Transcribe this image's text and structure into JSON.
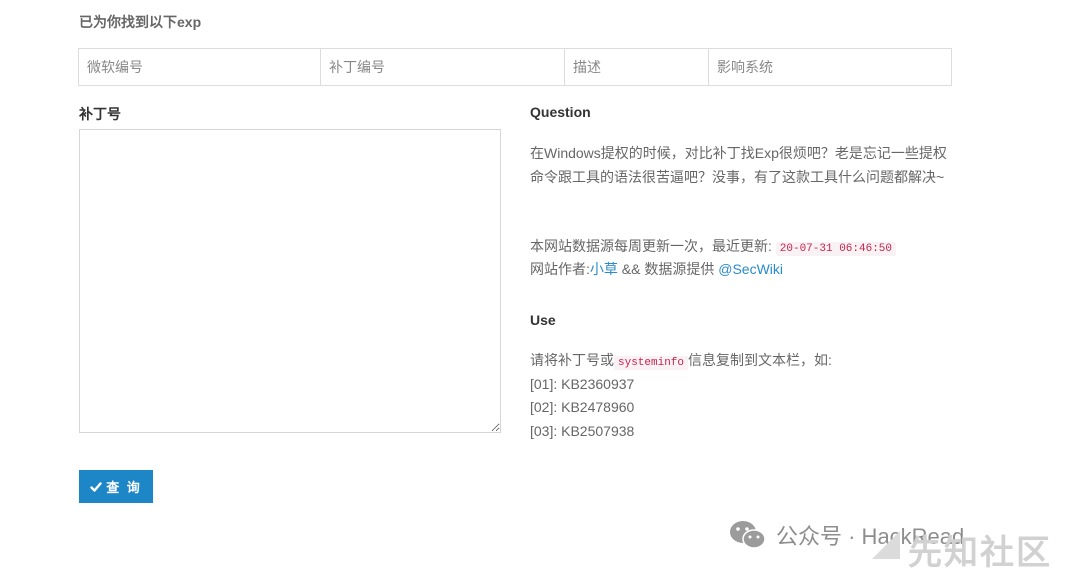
{
  "heading": "已为你找到以下exp",
  "table": {
    "columns": [
      "微软编号",
      "补丁编号",
      "描述",
      "影响系统"
    ]
  },
  "patch": {
    "label": "补丁号",
    "value": ""
  },
  "query_button": {
    "label": "查 询",
    "icon": "check-icon"
  },
  "question": {
    "title": "Question",
    "text": "在Windows提权的时候，对比补丁找Exp很烦吧？老是忘记一些提权命令跟工具的语法很苦逼吧？没事，有了这款工具什么问题都解决~",
    "update_prefix": "本网站数据源每周更新一次，最近更新:",
    "update_time": "20-07-31 06:46:50",
    "author_prefix": "网站作者:",
    "author_name": "小草",
    "author_mid": " && 数据源提供 ",
    "source_name": "@SecWiki"
  },
  "use": {
    "title": "Use",
    "intro_prefix": "请将补丁号或",
    "intro_code": "systeminfo",
    "intro_suffix": "信息复制到文本栏，如:",
    "examples": [
      "[01]: KB2360937",
      "[02]: KB2478960",
      "[03]: KB2507938"
    ]
  },
  "watermark": {
    "text": "公众号 · HackRead",
    "sub": "先知社区",
    "icon": "wechat-icon"
  },
  "colors": {
    "accent": "#1c86c7",
    "link": "#2a8bc9",
    "code": "#c7254e"
  }
}
